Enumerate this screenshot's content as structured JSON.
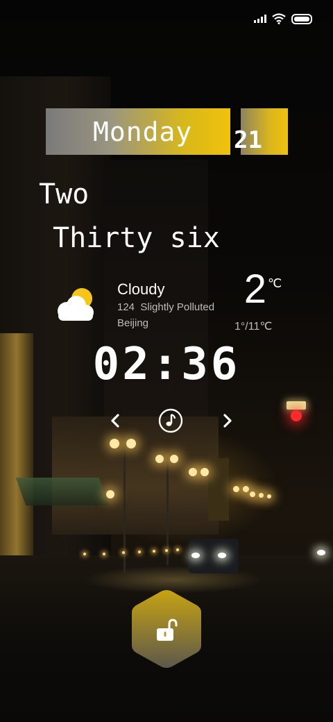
{
  "status_bar": {
    "icons": [
      "signal-icon",
      "wifi-icon",
      "battery-icon"
    ]
  },
  "date": {
    "day": "Monday",
    "date_number": "21"
  },
  "time_words": {
    "hour": "Two",
    "minutes": "Thirty six"
  },
  "weather": {
    "icon": "partly-cloudy-icon",
    "condition": "Cloudy",
    "air_quality": "124  Slightly Polluted",
    "city": "Beijing",
    "temperature": "2",
    "unit": "℃",
    "range": "1°/11℃"
  },
  "clock": {
    "time": "02:36"
  },
  "music": {
    "icons": [
      "previous-icon",
      "music-note-icon",
      "next-icon"
    ]
  },
  "unlock": {
    "icon": "unlock-icon"
  },
  "colors": {
    "accent_yellow": "#f0c20c",
    "banner_gray": "#7a7a7a",
    "subtext": "#bdbdbd"
  }
}
